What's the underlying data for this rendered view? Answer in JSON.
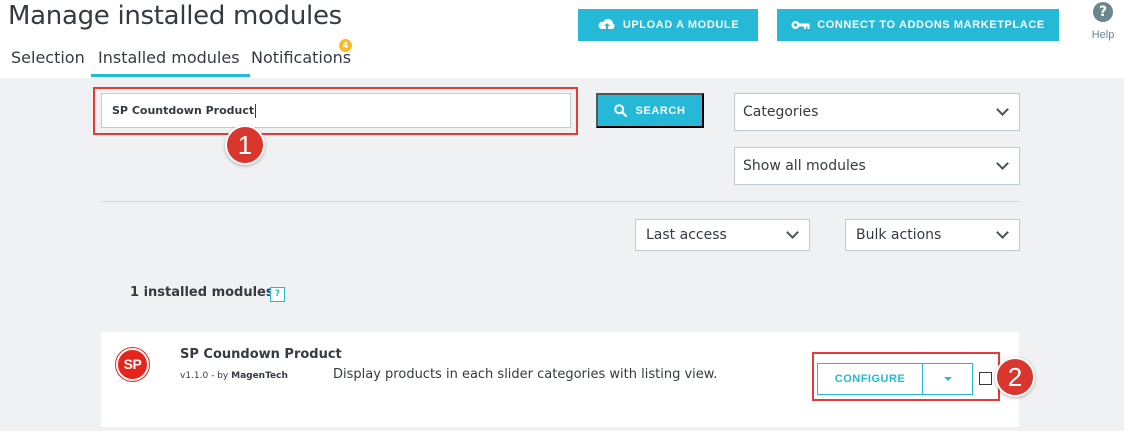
{
  "header": {
    "title": "Manage installed modules",
    "upload_label": "UPLOAD A MODULE",
    "addons_label": "CONNECT TO ADDONS MARKETPLACE",
    "help_label": "Help",
    "help_glyph": "?"
  },
  "tabs": [
    {
      "label": "Selection"
    },
    {
      "label": "Installed modules",
      "active": true
    },
    {
      "label": "Notifications",
      "badge": "4"
    }
  ],
  "search": {
    "value": "SP Countdown Product",
    "button_label": "SEARCH"
  },
  "filters": {
    "categories": "Categories",
    "status": "Show all modules",
    "sort": "Last access",
    "bulk": "Bulk actions"
  },
  "list": {
    "count_label": "1 installed modules",
    "count_help": "?"
  },
  "module": {
    "logo_text": "SP",
    "name": "SP Coundown Product",
    "version": "v1.1.0 - by",
    "author": "MagenTech",
    "description": "Display products in each slider categories with listing view.",
    "configure_label": "CONFIGURE"
  },
  "annotations": {
    "step1": "1",
    "step2": "2"
  },
  "colors": {
    "accent": "#25b9d7",
    "highlight": "#e53a3a",
    "badge": "#fbbb22",
    "logo": "#e5251c"
  }
}
